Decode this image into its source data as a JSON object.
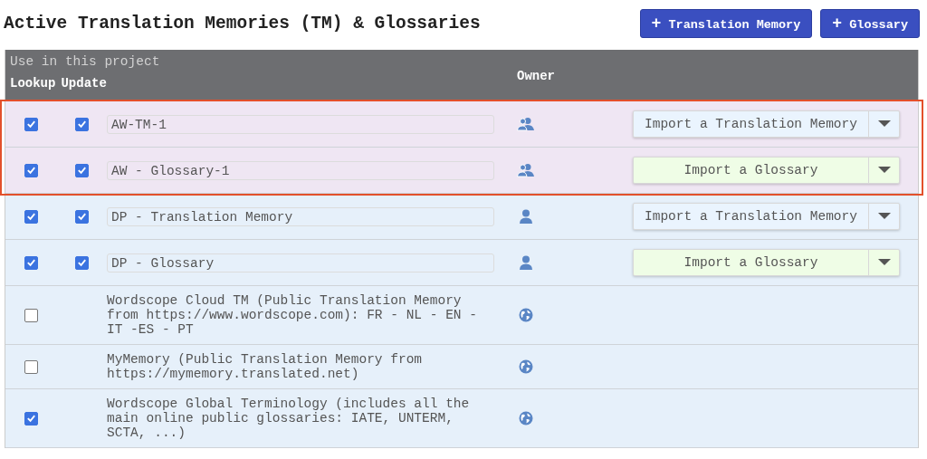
{
  "title": "Active Translation Memories (TM) & Glossaries",
  "actions": [
    {
      "icon": "+",
      "label": "Translation Memory"
    },
    {
      "icon": "+",
      "label": "Glossary"
    }
  ],
  "table": {
    "header": {
      "caption": "Use in this project",
      "lookup": "Lookup",
      "update": "Update",
      "owner": "Owner"
    },
    "groups": [
      {
        "highlighted": true,
        "rows": [
          {
            "kind": "editable",
            "lookup": true,
            "update": true,
            "name": "AW-TM-1",
            "owner": {
              "kind": "shared"
            },
            "import": {
              "kind": "tm",
              "label": "Import a Translation Memory"
            }
          },
          {
            "kind": "editable",
            "lookup": true,
            "update": true,
            "name": "AW - Glossary-1",
            "owner": {
              "kind": "shared"
            },
            "import": {
              "kind": "glossary",
              "label": "Import a Glossary"
            }
          }
        ]
      },
      {
        "highlighted": false,
        "rows": [
          {
            "kind": "editable",
            "lookup": true,
            "update": true,
            "name": "DP - Translation Memory",
            "owner": {
              "kind": "self"
            },
            "import": {
              "kind": "tm",
              "label": "Import a Translation Memory"
            }
          },
          {
            "kind": "editable",
            "lookup": true,
            "update": true,
            "name": "DP - Glossary",
            "owner": {
              "kind": "self"
            },
            "import": {
              "kind": "glossary",
              "label": "Import a Glossary"
            }
          },
          {
            "kind": "public",
            "lookup": false,
            "description": "Wordscope Cloud TM (Public Translation Memory from https://www.wordscope.com): FR - NL - EN - IT -ES - PT",
            "owner": {
              "kind": "public"
            }
          },
          {
            "kind": "public",
            "lookup": false,
            "description": "MyMemory (Public Translation Memory from https://mymemory.translated.net)",
            "owner": {
              "kind": "public"
            }
          },
          {
            "kind": "public",
            "lookup": true,
            "description": "Wordscope Global Terminology (includes all the main online public glossaries: IATE, UNTERM, SCTA, ...)",
            "owner": {
              "kind": "public"
            }
          }
        ]
      }
    ]
  }
}
